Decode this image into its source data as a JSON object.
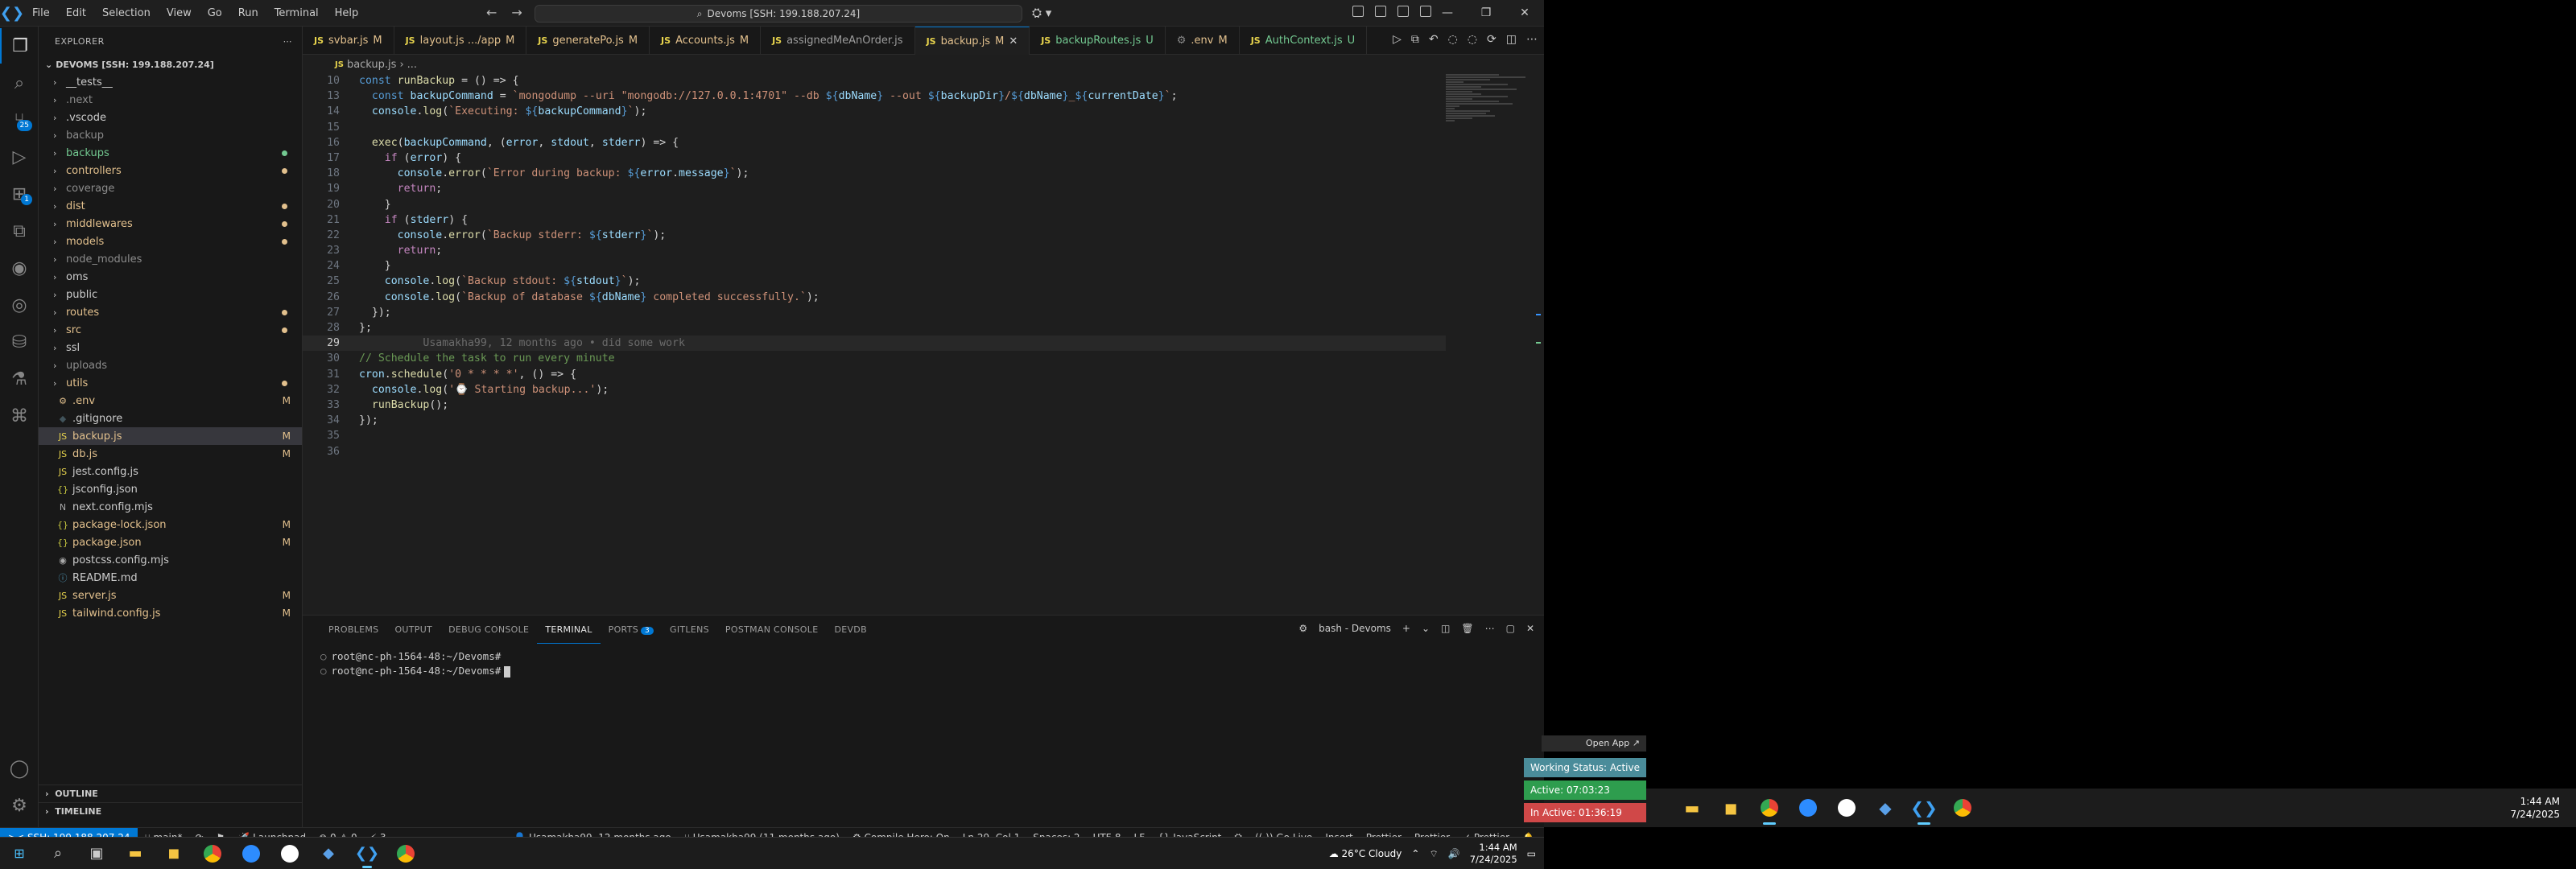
{
  "titlebar": {
    "menu": [
      "File",
      "Edit",
      "Selection",
      "View",
      "Go",
      "Run",
      "Terminal",
      "Help"
    ],
    "command_center": "Devoms [SSH: 199.188.207.24]"
  },
  "sidebar": {
    "header": "EXPLORER",
    "root": "DEVOMS [SSH: 199.188.207.24]",
    "items": [
      {
        "label": "__tests__",
        "type": "folder",
        "color": "white",
        "status": ""
      },
      {
        "label": ".next",
        "type": "folder",
        "color": "dim",
        "status": ""
      },
      {
        "label": ".vscode",
        "type": "folder",
        "color": "white",
        "status": ""
      },
      {
        "label": "backup",
        "type": "folder",
        "color": "dim",
        "status": ""
      },
      {
        "label": "backups",
        "type": "folder",
        "color": "green",
        "status": "dot"
      },
      {
        "label": "controllers",
        "type": "folder",
        "color": "orange",
        "status": "dot"
      },
      {
        "label": "coverage",
        "type": "folder",
        "color": "dim",
        "status": ""
      },
      {
        "label": "dist",
        "type": "folder",
        "color": "orange",
        "status": "dot"
      },
      {
        "label": "middlewares",
        "type": "folder",
        "color": "orange",
        "status": "dot"
      },
      {
        "label": "models",
        "type": "folder",
        "color": "orange",
        "status": "dot"
      },
      {
        "label": "node_modules",
        "type": "folder",
        "color": "dim",
        "status": ""
      },
      {
        "label": "oms",
        "type": "folder",
        "color": "white",
        "status": ""
      },
      {
        "label": "public",
        "type": "folder",
        "color": "white",
        "status": ""
      },
      {
        "label": "routes",
        "type": "folder",
        "color": "orange",
        "status": "dot"
      },
      {
        "label": "src",
        "type": "folder",
        "color": "orange",
        "status": "dot"
      },
      {
        "label": "ssl",
        "type": "folder",
        "color": "white",
        "status": ""
      },
      {
        "label": "uploads",
        "type": "folder",
        "color": "dim",
        "status": ""
      },
      {
        "label": "utils",
        "type": "folder",
        "color": "orange",
        "status": "dot"
      },
      {
        "label": ".env",
        "type": "file",
        "icon": "⚙",
        "color": "orange",
        "status": "M"
      },
      {
        "label": ".gitignore",
        "type": "file",
        "icon": "◆",
        "color": "white",
        "status": ""
      },
      {
        "label": "backup.js",
        "type": "file",
        "icon": "JS",
        "color": "orange",
        "status": "M",
        "selected": true
      },
      {
        "label": "db.js",
        "type": "file",
        "icon": "JS",
        "color": "orange",
        "status": "M"
      },
      {
        "label": "jest.config.js",
        "type": "file",
        "icon": "JS",
        "color": "white",
        "status": ""
      },
      {
        "label": "jsconfig.json",
        "type": "file",
        "icon": "{}",
        "color": "white",
        "status": ""
      },
      {
        "label": "next.config.mjs",
        "type": "file",
        "icon": "N",
        "color": "white",
        "status": ""
      },
      {
        "label": "package-lock.json",
        "type": "file",
        "icon": "{}",
        "color": "orange",
        "status": "M"
      },
      {
        "label": "package.json",
        "type": "file",
        "icon": "{}",
        "color": "orange",
        "status": "M"
      },
      {
        "label": "postcss.config.mjs",
        "type": "file",
        "icon": "◉",
        "color": "white",
        "status": ""
      },
      {
        "label": "README.md",
        "type": "file",
        "icon": "ⓘ",
        "color": "white",
        "status": ""
      },
      {
        "label": "server.js",
        "type": "file",
        "icon": "JS",
        "color": "orange",
        "status": "M"
      },
      {
        "label": "tailwind.config.js",
        "type": "file",
        "icon": "JS",
        "color": "orange",
        "status": "M"
      }
    ],
    "outline": "OUTLINE",
    "timeline": "TIMELINE"
  },
  "tabs": [
    {
      "label": "svbar.js",
      "mark": "M",
      "kind": "mod"
    },
    {
      "label": "layout.js .../app",
      "mark": "M",
      "kind": "mod"
    },
    {
      "label": "generatePo.js",
      "mark": "M",
      "kind": "mod"
    },
    {
      "label": "Accounts.js",
      "mark": "M",
      "kind": "mod"
    },
    {
      "label": "assignedMeAnOrder.js",
      "mark": "",
      "kind": "plain"
    },
    {
      "label": "backup.js",
      "mark": "M",
      "kind": "mod",
      "active": true
    },
    {
      "label": "backupRoutes.js",
      "mark": "U",
      "kind": "unt"
    },
    {
      "label": ".env",
      "mark": "M",
      "kind": "mod",
      "gear": true
    },
    {
      "label": "AuthContext.js",
      "mark": "U",
      "kind": "unt"
    }
  ],
  "breadcrumb": [
    "backup.js",
    "..."
  ],
  "code": {
    "lines": [
      {
        "n": "10",
        "html": "<span class='kw'>const</span> <span class='fn'>runBackup</span> <span class='pun'>=</span> <span class='pun'>() =&gt; {</span>"
      },
      {
        "n": "13",
        "html": "  <span class='kw'>const</span> <span class='var'>backupCommand</span> <span class='pun'>=</span> <span class='tpl'>`mongodump --uri \"mongodb://127.0.0.1:4701\" --db </span><span class='tb'>${</span><span class='tv'>dbName</span><span class='tb'>}</span><span class='tpl'> --out </span><span class='tb'>${</span><span class='tv'>backupDir</span><span class='tb'>}</span><span class='tpl'>/</span><span class='tb'>${</span><span class='tv'>dbName</span><span class='tb'>}</span><span class='tpl'>_</span><span class='tb'>${</span><span class='tv'>currentDate</span><span class='tb'>}</span><span class='tpl'>`</span><span class='pun'>;</span>"
      },
      {
        "n": "14",
        "html": "  <span class='var'>console</span><span class='pun'>.</span><span class='fn'>log</span><span class='pun'>(</span><span class='tpl'>`Executing: </span><span class='tb'>${</span><span class='tv'>backupCommand</span><span class='tb'>}</span><span class='tpl'>`</span><span class='pun'>);</span>"
      },
      {
        "n": "15",
        "html": ""
      },
      {
        "n": "16",
        "html": "  <span class='fn'>exec</span><span class='pun'>(</span><span class='var'>backupCommand</span><span class='pun'>, (</span><span class='var'>error</span><span class='pun'>,</span> <span class='var'>stdout</span><span class='pun'>,</span> <span class='var'>stderr</span><span class='pun'>) =&gt; {</span>"
      },
      {
        "n": "17",
        "html": "    <span class='ctl'>if</span> <span class='pun'>(</span><span class='var'>error</span><span class='pun'>) {</span>"
      },
      {
        "n": "18",
        "html": "      <span class='var'>console</span><span class='pun'>.</span><span class='fn'>error</span><span class='pun'>(</span><span class='tpl'>`Error during backup: </span><span class='tb'>${</span><span class='tv'>error</span><span class='pun'>.</span><span class='tv'>message</span><span class='tb'>}</span><span class='tpl'>`</span><span class='pun'>);</span>"
      },
      {
        "n": "19",
        "html": "      <span class='ctl'>return</span><span class='pun'>;</span>"
      },
      {
        "n": "20",
        "html": "    <span class='pun'>}</span>"
      },
      {
        "n": "21",
        "html": "    <span class='ctl'>if</span> <span class='pun'>(</span><span class='var'>stderr</span><span class='pun'>) {</span>"
      },
      {
        "n": "22",
        "html": "      <span class='var'>console</span><span class='pun'>.</span><span class='fn'>error</span><span class='pun'>(</span><span class='tpl'>`Backup stderr: </span><span class='tb'>${</span><span class='tv'>stderr</span><span class='tb'>}</span><span class='tpl'>`</span><span class='pun'>);</span>"
      },
      {
        "n": "23",
        "html": "      <span class='ctl'>return</span><span class='pun'>;</span>"
      },
      {
        "n": "24",
        "html": "    <span class='pun'>}</span>"
      },
      {
        "n": "25",
        "html": "    <span class='var'>console</span><span class='pun'>.</span><span class='fn'>log</span><span class='pun'>(</span><span class='tpl'>`Backup stdout: </span><span class='tb'>${</span><span class='tv'>stdout</span><span class='tb'>}</span><span class='tpl'>`</span><span class='pun'>);</span>"
      },
      {
        "n": "26",
        "html": "    <span class='var'>console</span><span class='pun'>.</span><span class='fn'>log</span><span class='pun'>(</span><span class='tpl'>`Backup of database </span><span class='tb'>${</span><span class='tv'>dbName</span><span class='tb'>}</span><span class='tpl'> completed successfully.`</span><span class='pun'>);</span>"
      },
      {
        "n": "27",
        "html": "  <span class='pun'>});</span>"
      },
      {
        "n": "28",
        "html": "<span class='pun'>};</span>"
      },
      {
        "n": "29",
        "html": "          <span class='blame'>Usamakha99, 12 months ago • did some work</span>",
        "current": true
      },
      {
        "n": "30",
        "html": "<span class='cm'>// Schedule the task to run every minute</span>"
      },
      {
        "n": "31",
        "html": "<span class='var'>cron</span><span class='pun'>.</span><span class='fn'>schedule</span><span class='pun'>(</span><span class='str'>'0 * * * *'</span><span class='pun'>, () =&gt; {</span>"
      },
      {
        "n": "32",
        "html": "  <span class='var'>console</span><span class='pun'>.</span><span class='fn'>log</span><span class='pun'>(</span><span class='str'>'⌚ Starting backup...'</span><span class='pun'>);</span>"
      },
      {
        "n": "33",
        "html": "  <span class='fn'>runBackup</span><span class='pun'>();</span>"
      },
      {
        "n": "34",
        "html": "<span class='pun'>});</span>"
      },
      {
        "n": "35",
        "html": ""
      },
      {
        "n": "36",
        "html": ""
      }
    ]
  },
  "panel": {
    "tabs": [
      "PROBLEMS",
      "OUTPUT",
      "DEBUG CONSOLE",
      "TERMINAL",
      "PORTS",
      "GITLENS",
      "POSTMAN CONSOLE",
      "DEVDB"
    ],
    "active_tab": "TERMINAL",
    "ports_badge": "3",
    "terminal_name": "bash - Devoms",
    "terminal_lines": [
      "root@nc-ph-1564-48:~/Devoms#",
      "root@nc-ph-1564-48:~/Devoms#"
    ]
  },
  "statusbar": {
    "remote": "SSH: 199.188.207.24",
    "branch": "main*",
    "launchpad": "Launchpad",
    "problems": "⊗ 0 ⚠ 0",
    "ports": "3",
    "blame": "Usamakha99, 12 months ago",
    "author": "Usamakha99 (11 months ago)",
    "compile_hero": "Compile Hero: On",
    "position": "Ln 29, Col 1",
    "spaces": "Spaces: 2",
    "encoding": "UTF-8",
    "eol": "LF",
    "language": "JavaScript",
    "golive": "Go Live",
    "insert": "Insert",
    "prettier1": "Prettier",
    "prettier2": "Prettier",
    "prettier3": "Prettier"
  },
  "taskbar": {
    "weather": "26°C  Cloudy",
    "time": "1:44 AM",
    "date": "7/24/2025"
  },
  "overlay": {
    "open_app": "Open App ↗",
    "working_status": "Working Status: Active",
    "active": "Active: 07:03:23",
    "inactive": "In Active: 01:36:19"
  },
  "taskbar2": {
    "time": "1:44 AM",
    "date": "7/24/2025"
  },
  "colors": {
    "accent": "#0078d4",
    "working_status_bg": "#4a8c9a",
    "active_bg": "#2e9d4e",
    "inactive_bg": "#d04848"
  }
}
